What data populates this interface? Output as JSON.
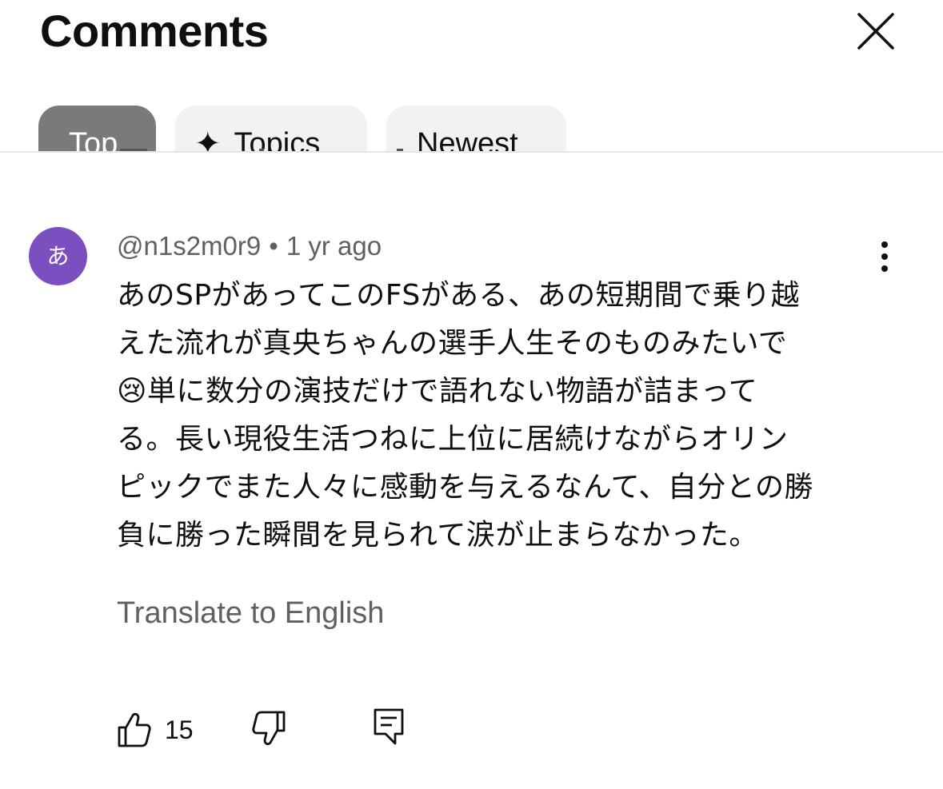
{
  "header": {
    "title": "Comments",
    "close_icon": "close-icon"
  },
  "filters": [
    {
      "label": "Top",
      "selected": true
    },
    {
      "label": "Topics",
      "icon": "sparkle-icon"
    },
    {
      "label": "Newest"
    }
  ],
  "comment": {
    "avatar_initial": "あ",
    "avatar_color": "#7b4fc0",
    "author": "@n1s2m0r9",
    "separator": "•",
    "time": "1 yr ago",
    "lines": [
      "あのSPがあってこのFSがある、あの短期間で乗り越",
      "えた流れが真央ちゃんの選手人生そのものみたいで",
      "😢単に数分の演技だけで語れない物語が詰まって",
      "る。長い現役生活つねに上位に居続けながらオリン",
      "ピックでまた人々に感動を与えるなんて、自分との勝",
      "負に勝った瞬間を見られて涙が止まらなかった。"
    ],
    "translate_label": "Translate to English",
    "like_count": "15"
  }
}
